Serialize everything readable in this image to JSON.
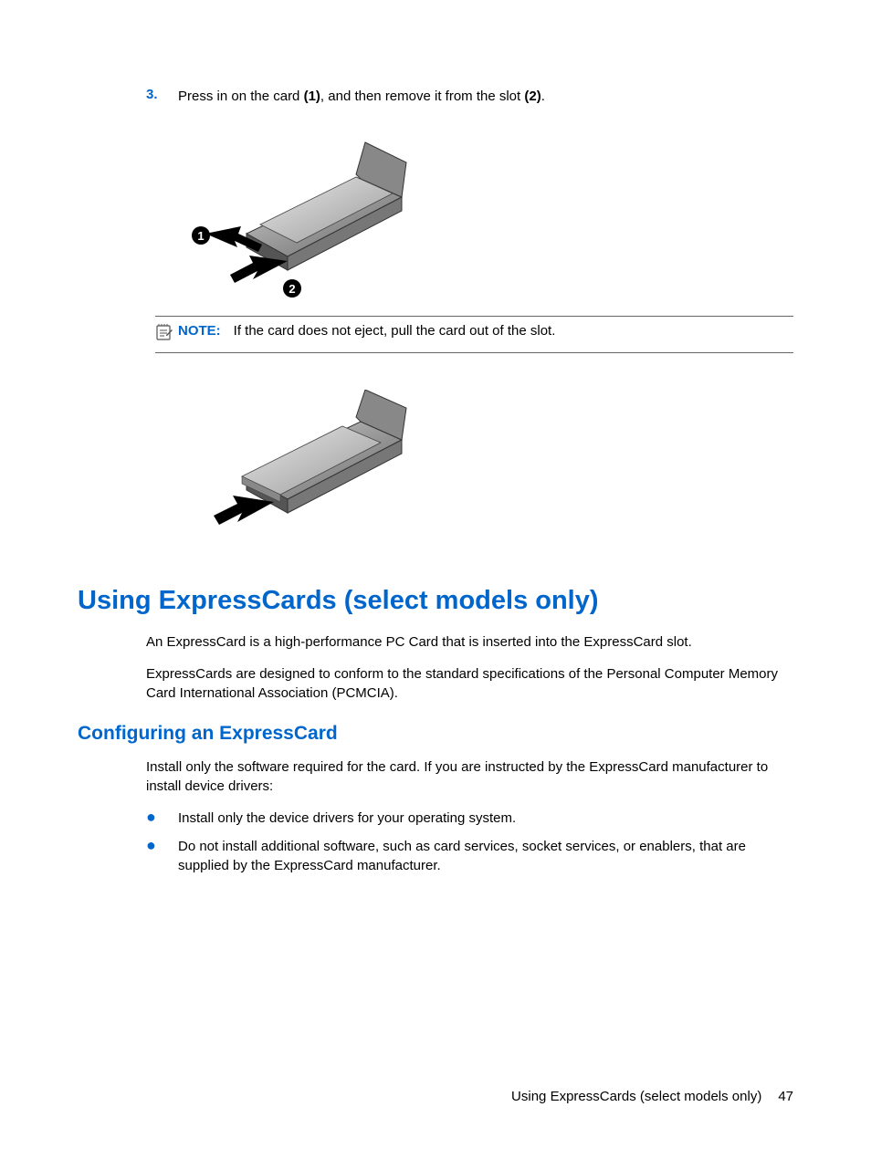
{
  "step3": {
    "number": "3.",
    "text_before": "Press in on the card ",
    "bold1": "(1)",
    "text_mid": ", and then remove it from the slot ",
    "bold2": "(2)",
    "text_after": "."
  },
  "note": {
    "label": "NOTE:",
    "text": "If the card does not eject, pull the card out of the slot."
  },
  "section": {
    "title": "Using ExpressCards (select models only)",
    "para1": "An ExpressCard is a high-performance PC Card that is inserted into the ExpressCard slot.",
    "para2": "ExpressCards are designed to conform to the standard specifications of the Personal Computer Memory Card International Association (PCMCIA)."
  },
  "subsection": {
    "title": "Configuring an ExpressCard",
    "para": "Install only the software required for the card. If you are instructed by the ExpressCard manufacturer to install device drivers:",
    "bullets": [
      "Install only the device drivers for your operating system.",
      "Do not install additional software, such as card services, socket services, or enablers, that are supplied by the ExpressCard manufacturer."
    ]
  },
  "footer": {
    "text": "Using ExpressCards (select models only)",
    "page": "47"
  }
}
